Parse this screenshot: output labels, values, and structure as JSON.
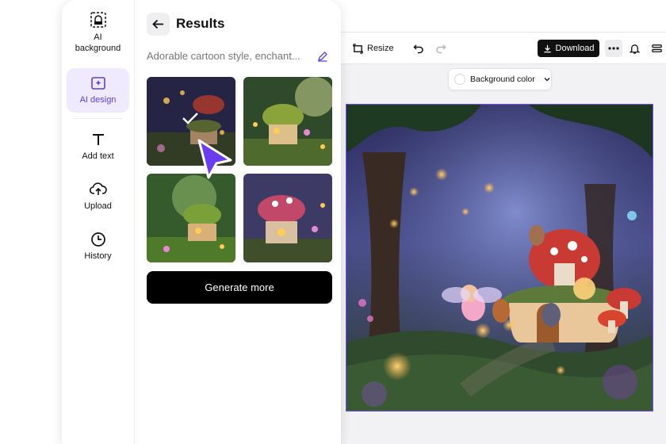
{
  "toolbar": {
    "resize_label": "Resize",
    "download_label": "Download",
    "icons": [
      "resize-icon",
      "undo-icon",
      "redo-icon",
      "download-icon",
      "more-icon",
      "bell-icon",
      "layers-icon"
    ]
  },
  "background_color": {
    "label": "Background color",
    "value": "#ffffff"
  },
  "sidebar": {
    "items": [
      {
        "label": "AI background",
        "icon": "ai-background-icon",
        "active": false
      },
      {
        "label": "AI design",
        "icon": "ai-design-icon",
        "active": true
      },
      {
        "label": "Add text",
        "icon": "text-icon",
        "active": false
      },
      {
        "label": "Upload",
        "icon": "upload-icon",
        "active": false
      },
      {
        "label": "History",
        "icon": "history-icon",
        "active": false
      }
    ]
  },
  "results": {
    "title": "Results",
    "prompt": "Adorable cartoon style, enchant...",
    "selected_index": 0,
    "generate_more_label": "Generate more"
  },
  "colors": {
    "accent": "#5b3ee0",
    "active_bg": "#efeafd",
    "canvas_border": "#6a4cff",
    "primary_button": "#000000"
  }
}
